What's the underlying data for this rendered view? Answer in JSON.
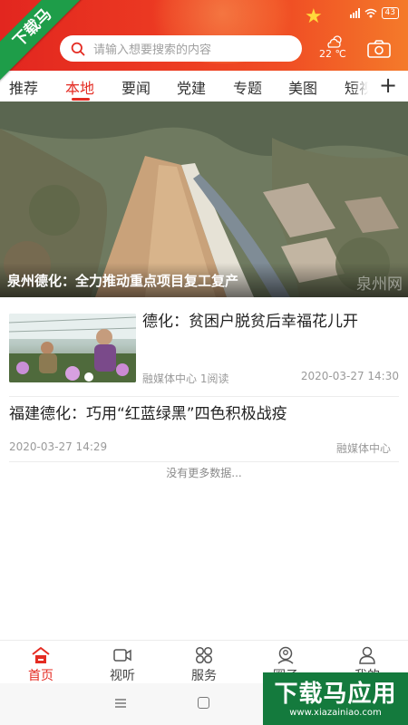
{
  "status_bar": {
    "battery": "43"
  },
  "watermark": {
    "corner_text": "下载马",
    "banner_text": "下载马应用",
    "banner_url": "www.xiazainiao.com"
  },
  "search": {
    "placeholder": "请输入想要搜索的内容"
  },
  "weather": {
    "temperature": "22 ℃",
    "icon": "cloud-sun-icon"
  },
  "tabs": [
    {
      "label": "推荐",
      "active": false
    },
    {
      "label": "本地",
      "active": true
    },
    {
      "label": "要闻",
      "active": false
    },
    {
      "label": "党建",
      "active": false
    },
    {
      "label": "专题",
      "active": false
    },
    {
      "label": "美图",
      "active": false
    },
    {
      "label": "短视",
      "active": false
    }
  ],
  "tabs_add": "+",
  "hero": {
    "title": "泉州德化：全力推动重点项目复工复产",
    "watermark": "泉州网"
  },
  "news": [
    {
      "title": "德化：贫困户脱贫后幸福花儿开",
      "source": "融媒体中心",
      "reads": "1阅读",
      "time": "2020-03-27 14:30"
    },
    {
      "title": "福建德化：巧用“红蓝绿黑”四色积极战疫",
      "source": "融媒体中心",
      "time": "2020-03-27 14:29"
    }
  ],
  "list_end": "没有更多数据...",
  "bottom_nav": [
    {
      "label": "首页",
      "icon": "home-icon",
      "active": true
    },
    {
      "label": "视听",
      "icon": "video-icon",
      "active": false
    },
    {
      "label": "服务",
      "icon": "grid-icon",
      "active": false
    },
    {
      "label": "圈子",
      "icon": "community-icon",
      "active": false
    },
    {
      "label": "我的",
      "icon": "user-icon",
      "active": false
    }
  ],
  "colors": {
    "accent": "#e42b22",
    "header_start": "#e2261f",
    "header_end": "#f47a2a",
    "watermark_green": "#1e9d49"
  }
}
